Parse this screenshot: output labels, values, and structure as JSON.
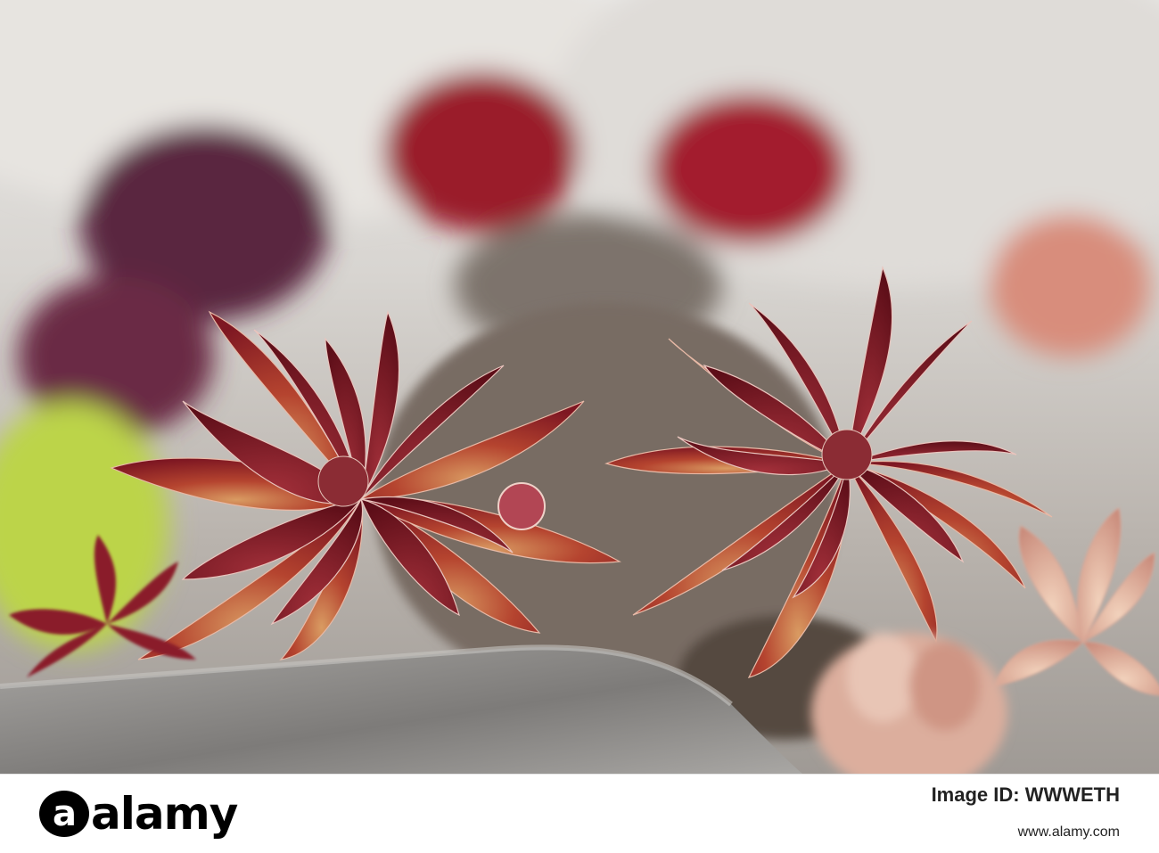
{
  "photo": {
    "subject": "Red houseleek succulent rosettes between rocks",
    "colors": {
      "rock_light": "#d9d6d2",
      "rock_dark": "#8e8b88",
      "leaf_red": "#8c1b26",
      "leaf_dark": "#5b0d15",
      "leaf_tip_orange": "#d07a4a",
      "moss_green": "#b8d24a"
    }
  },
  "watermark": {
    "logo_letter": "a",
    "logo_rest": "alamy",
    "image_id_label": "Image ID: WWWETH",
    "url": "www.alamy.com"
  }
}
